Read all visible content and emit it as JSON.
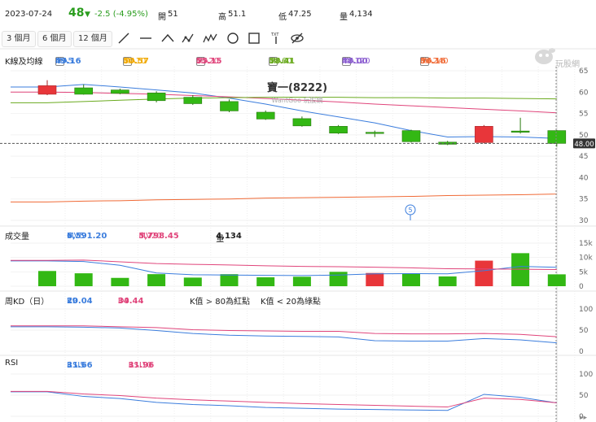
{
  "quote": {
    "date": "2023-07-24",
    "price": "48",
    "change": "-2.5 (-4.95%)",
    "open_label": "開",
    "open": "51",
    "high_label": "高",
    "high": "51.1",
    "low_label": "低",
    "low": "47.25",
    "volume_label": "量",
    "volume": "4,134"
  },
  "toolbar": {
    "ranges": [
      "3 個月",
      "6 個月",
      "12 個月"
    ],
    "tools": [
      "trendline-icon",
      "horizontal-line-icon",
      "polyline-icon",
      "pattern-icon",
      "wave-icon",
      "circle-icon",
      "rectangle-icon",
      "text-icon",
      "hide-drawings-icon"
    ]
  },
  "price_panel": {
    "title": "K線及均線",
    "ma_items": [
      {
        "label": "MA5",
        "value": "49.16",
        "arrow": "↓",
        "checked": true,
        "color": "#3b7ddd"
      },
      {
        "label": "MA10",
        "value": "50.57",
        "arrow": "↓",
        "checked": false,
        "color": "#f0a800"
      },
      {
        "label": "MA20",
        "value": "55.15",
        "arrow": "↓",
        "checked": true,
        "color": "#e0457b"
      },
      {
        "label": "MA60",
        "value": "58.41",
        "arrow": "↓",
        "checked": true,
        "color": "#6aaa1e"
      },
      {
        "label": "MA120",
        "value": "48.00",
        "arrow": "↑",
        "checked": false,
        "color": "#8a5cd0"
      },
      {
        "label": "MA240",
        "value": "36.16",
        "arrow": "↑",
        "checked": true,
        "color": "#f06a36"
      }
    ],
    "stock_name": "寶一(8222)",
    "watermark": "WantGoo 玩股網",
    "logo_text": "玩股網",
    "last_price_tag": "48.00",
    "event_marker": "5"
  },
  "volume_panel": {
    "title": "成交量",
    "items": [
      {
        "label": "MV5",
        "value": "6,591.20",
        "arrow": "↓",
        "color": "#3b7ddd"
      },
      {
        "label": "MV20",
        "value": "5,798.45",
        "arrow": "↑",
        "color": "#e0457b"
      },
      {
        "label": "量",
        "value": "4,134",
        "arrow": "↓",
        "color": "#222222"
      }
    ]
  },
  "kd_panel": {
    "title": "周KD（日）",
    "items": [
      {
        "label": "K9",
        "value": "20.04",
        "arrow": "↓",
        "color": "#3b7ddd"
      },
      {
        "label": "D9",
        "value": "34.44",
        "arrow": "↓",
        "color": "#e0457b"
      }
    ],
    "notes": [
      "K值 > 80為紅點",
      "K值 < 20為綠點"
    ]
  },
  "rsi_panel": {
    "title": "RSI",
    "items": [
      {
        "label": "RSI5",
        "value": "31.66",
        "arrow": "↓",
        "color": "#3b7ddd"
      },
      {
        "label": "RSI10",
        "value": "31.96",
        "arrow": "↓",
        "color": "#e0457b"
      }
    ]
  },
  "chart_data": [
    {
      "type": "candlestick",
      "title": "寶一(8222)",
      "ylim": [
        30,
        65
      ],
      "yticks": [
        30,
        35,
        40,
        45,
        50,
        55,
        60,
        65
      ],
      "candles": [
        {
          "o": 59.5,
          "h": 62.8,
          "l": 59.3,
          "c": 61.5
        },
        {
          "o": 61.0,
          "h": 61.8,
          "l": 59.4,
          "c": 59.5
        },
        {
          "o": 60.5,
          "h": 60.8,
          "l": 59.5,
          "c": 59.7
        },
        {
          "o": 59.8,
          "h": 60.2,
          "l": 57.6,
          "c": 58.0
        },
        {
          "o": 58.8,
          "h": 59.3,
          "l": 57.0,
          "c": 57.3
        },
        {
          "o": 57.8,
          "h": 58.3,
          "l": 55.3,
          "c": 55.6
        },
        {
          "o": 55.3,
          "h": 55.7,
          "l": 53.5,
          "c": 53.7
        },
        {
          "o": 53.8,
          "h": 54.3,
          "l": 51.9,
          "c": 52.1
        },
        {
          "o": 52.0,
          "h": 52.3,
          "l": 50.2,
          "c": 50.4
        },
        {
          "o": 50.6,
          "h": 51.0,
          "l": 49.5,
          "c": 50.5
        },
        {
          "o": 51.0,
          "h": 51.2,
          "l": 48.2,
          "c": 48.4
        },
        {
          "o": 48.3,
          "h": 48.6,
          "l": 47.6,
          "c": 47.8
        },
        {
          "o": 48.2,
          "h": 52.3,
          "l": 48.0,
          "c": 52.0
        },
        {
          "o": 50.9,
          "h": 54.0,
          "l": 50.3,
          "c": 50.6
        },
        {
          "o": 51.0,
          "h": 51.1,
          "l": 47.25,
          "c": 48.0
        }
      ],
      "series": [
        {
          "name": "MA5",
          "values": [
            61.2,
            61.8,
            61.2,
            60.5,
            59.8,
            58.6,
            57.2,
            55.6,
            54.2,
            52.8,
            51.0,
            49.5,
            49.6,
            49.5,
            49.16
          ]
        },
        {
          "name": "MA20",
          "values": [
            60.0,
            59.9,
            59.7,
            59.5,
            59.2,
            58.9,
            58.5,
            58.1,
            57.7,
            57.2,
            56.8,
            56.4,
            56.0,
            55.6,
            55.15
          ]
        },
        {
          "name": "MA60",
          "values": [
            57.5,
            57.8,
            58.1,
            58.4,
            58.6,
            58.7,
            58.8,
            58.8,
            58.8,
            58.7,
            58.7,
            58.6,
            58.6,
            58.5,
            58.41
          ]
        },
        {
          "name": "MA240",
          "values": [
            34.3,
            34.5,
            34.6,
            34.8,
            34.9,
            35.0,
            35.2,
            35.3,
            35.4,
            35.5,
            35.6,
            35.8,
            35.9,
            36.0,
            36.16
          ]
        }
      ]
    },
    {
      "type": "bar",
      "title": "成交量",
      "ylim": [
        0,
        15000
      ],
      "yticks": [
        "15k",
        "10k",
        "5k",
        "0"
      ],
      "yticks_values": [
        15000,
        10000,
        5000,
        0
      ],
      "values": [
        5300,
        4500,
        2900,
        4200,
        3000,
        4200,
        3100,
        3300,
        5000,
        4600,
        4500,
        3400,
        8900,
        11500,
        4134
      ],
      "colors": [
        "g",
        "g",
        "g",
        "g",
        "g",
        "g",
        "g",
        "g",
        "g",
        "r",
        "g",
        "g",
        "r",
        "g",
        "g"
      ],
      "series": [
        {
          "name": "MV5",
          "values": [
            8800,
            8600,
            7300,
            4600,
            4000,
            3900,
            3800,
            3700,
            3900,
            4300,
            4400,
            4300,
            5400,
            6900,
            6591.2
          ]
        },
        {
          "name": "MV20",
          "values": [
            9000,
            9100,
            8500,
            7900,
            7600,
            7400,
            7100,
            6900,
            6800,
            6600,
            6400,
            6100,
            6000,
            5900,
            5798.45
          ]
        }
      ]
    },
    {
      "type": "line",
      "title": "周KD（日）",
      "ylim": [
        0,
        100
      ],
      "yticks": [
        0,
        50,
        100
      ],
      "series": [
        {
          "name": "K9",
          "values": [
            58,
            57,
            55,
            49,
            42,
            38,
            36,
            35,
            34,
            25,
            24,
            24,
            30,
            27,
            20.04
          ]
        },
        {
          "name": "D9",
          "values": [
            60,
            60,
            58,
            56,
            51,
            49,
            48,
            47,
            47,
            42,
            41,
            41,
            42,
            40,
            34.44
          ]
        }
      ]
    },
    {
      "type": "line",
      "title": "RSI",
      "ylim": [
        0,
        100
      ],
      "yticks": [
        0,
        50,
        100
      ],
      "series": [
        {
          "name": "RSI5",
          "values": [
            58,
            47,
            42,
            33,
            28,
            25,
            21,
            19,
            17,
            16,
            15,
            14,
            52,
            45,
            31.66
          ]
        },
        {
          "name": "RSI10",
          "values": [
            59,
            53,
            49,
            43,
            39,
            36,
            33,
            30,
            28,
            26,
            24,
            22,
            43,
            40,
            31.96
          ]
        }
      ]
    }
  ]
}
